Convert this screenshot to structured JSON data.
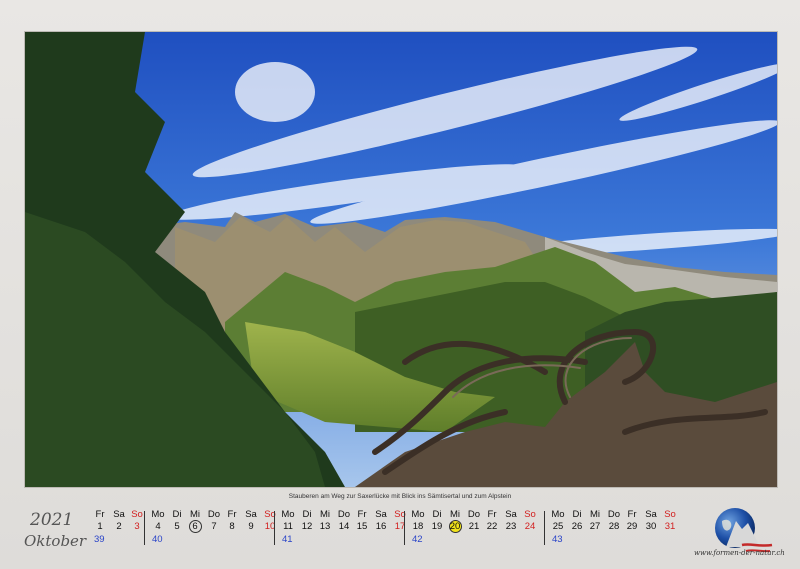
{
  "caption": "Stauberen am Weg zur Saxerlücke mit Blick ins Sämtisertal und zum Alpstein",
  "year": "2021",
  "month": "Oktober",
  "site": "www.formen-der-natur.ch",
  "colors": {
    "sunday": "#d22020",
    "week_number": "#2a44c8",
    "holiday_highlight": "#f1e31a"
  },
  "calendar": {
    "weeks": [
      {
        "number": "39",
        "days": [
          {
            "name": "Fr",
            "date": "1"
          },
          {
            "name": "Sa",
            "date": "2"
          },
          {
            "name": "So",
            "date": "3"
          }
        ]
      },
      {
        "number": "40",
        "days": [
          {
            "name": "Mo",
            "date": "4"
          },
          {
            "name": "Di",
            "date": "5"
          },
          {
            "name": "Mi",
            "date": "6"
          },
          {
            "name": "Do",
            "date": "7"
          },
          {
            "name": "Fr",
            "date": "8"
          },
          {
            "name": "Sa",
            "date": "9"
          },
          {
            "name": "So",
            "date": "10"
          }
        ]
      },
      {
        "number": "41",
        "days": [
          {
            "name": "Mo",
            "date": "11"
          },
          {
            "name": "Di",
            "date": "12"
          },
          {
            "name": "Mi",
            "date": "13"
          },
          {
            "name": "Do",
            "date": "14"
          },
          {
            "name": "Fr",
            "date": "15"
          },
          {
            "name": "Sa",
            "date": "16"
          },
          {
            "name": "So",
            "date": "17"
          }
        ]
      },
      {
        "number": "42",
        "days": [
          {
            "name": "Mo",
            "date": "18"
          },
          {
            "name": "Di",
            "date": "19"
          },
          {
            "name": "Mi",
            "date": "20"
          },
          {
            "name": "Do",
            "date": "21"
          },
          {
            "name": "Fr",
            "date": "22"
          },
          {
            "name": "Sa",
            "date": "23"
          },
          {
            "name": "So",
            "date": "24"
          }
        ]
      },
      {
        "number": "43",
        "days": [
          {
            "name": "Mo",
            "date": "25"
          },
          {
            "name": "Di",
            "date": "26"
          },
          {
            "name": "Mi",
            "date": "27"
          },
          {
            "name": "Do",
            "date": "28"
          },
          {
            "name": "Fr",
            "date": "29"
          },
          {
            "name": "Sa",
            "date": "30"
          },
          {
            "name": "So",
            "date": "31"
          }
        ]
      }
    ],
    "circled_dates": [
      "6",
      "20"
    ],
    "highlighted_dates": [
      "20"
    ]
  }
}
